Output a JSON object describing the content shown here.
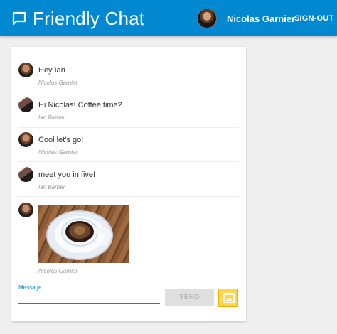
{
  "header": {
    "title": "Friendly Chat",
    "user_name": "Nicolas Garnier",
    "signout_label": "SIGN-OUT",
    "icons": [
      "chat-bubble-icon"
    ]
  },
  "messages": [
    {
      "text": "Hey Ian",
      "author": "Nicolas Garnier"
    },
    {
      "text": "Hi Nicolas! Coffee time?",
      "author": "Ian Barber"
    },
    {
      "text": "Cool let's go!",
      "author": "Nicolas Garnier"
    },
    {
      "text": "meet you in five!",
      "author": "Ian Barber"
    },
    {
      "text": "",
      "author": "Nicolas Garnier"
    }
  ],
  "composer": {
    "message_label": "Message...",
    "message_value": "",
    "send_label": "SEND",
    "image_icon": "image-icon"
  },
  "colors": {
    "accent": "#0288d1",
    "background": "#efefef",
    "image_button": "#ffd54f"
  }
}
